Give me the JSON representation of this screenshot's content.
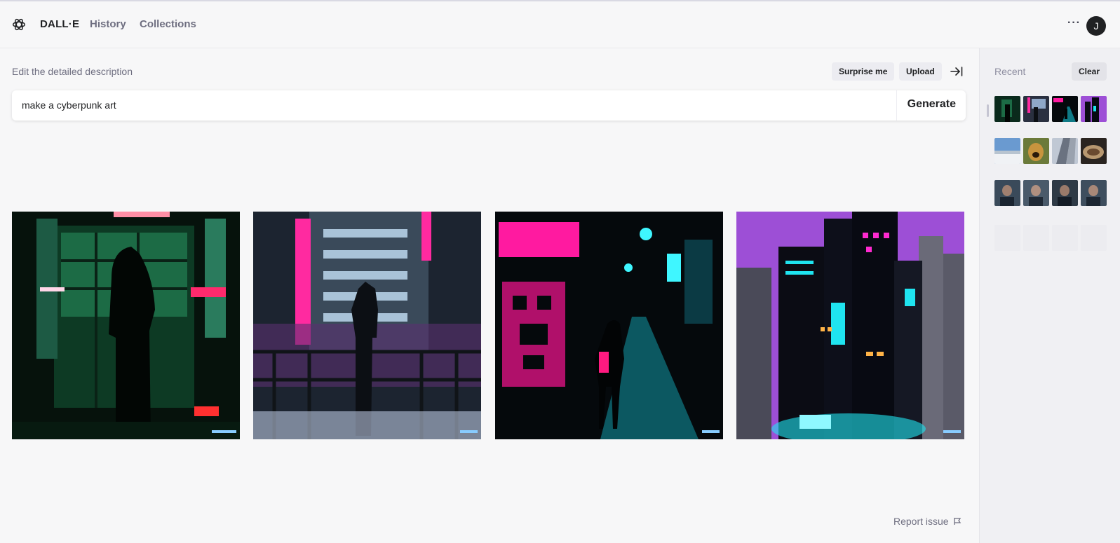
{
  "header": {
    "brand": "DALL·E",
    "nav": [
      "History",
      "Collections"
    ],
    "more_icon": "ellipsis-icon",
    "avatar_initial": "J"
  },
  "editor": {
    "description_label": "Edit the detailed description",
    "surprise_label": "Surprise me",
    "upload_label": "Upload",
    "prompt_value": "make a cyberpunk art",
    "generate_label": "Generate"
  },
  "results": {
    "images": [
      "cyberpunk-green-hooded-figure",
      "cyberpunk-neon-city-balcony",
      "cyberpunk-pink-teal-alley",
      "cyberpunk-purple-skyline"
    ]
  },
  "footer": {
    "report_label": "Report issue"
  },
  "sidebar": {
    "recent_label": "Recent",
    "clear_label": "Clear"
  },
  "colors": {
    "neon_pink": "#ff1aa8",
    "neon_cyan": "#1fe4f0",
    "neon_green": "#1aff8c",
    "purple_sky": "#9d4fd6"
  }
}
